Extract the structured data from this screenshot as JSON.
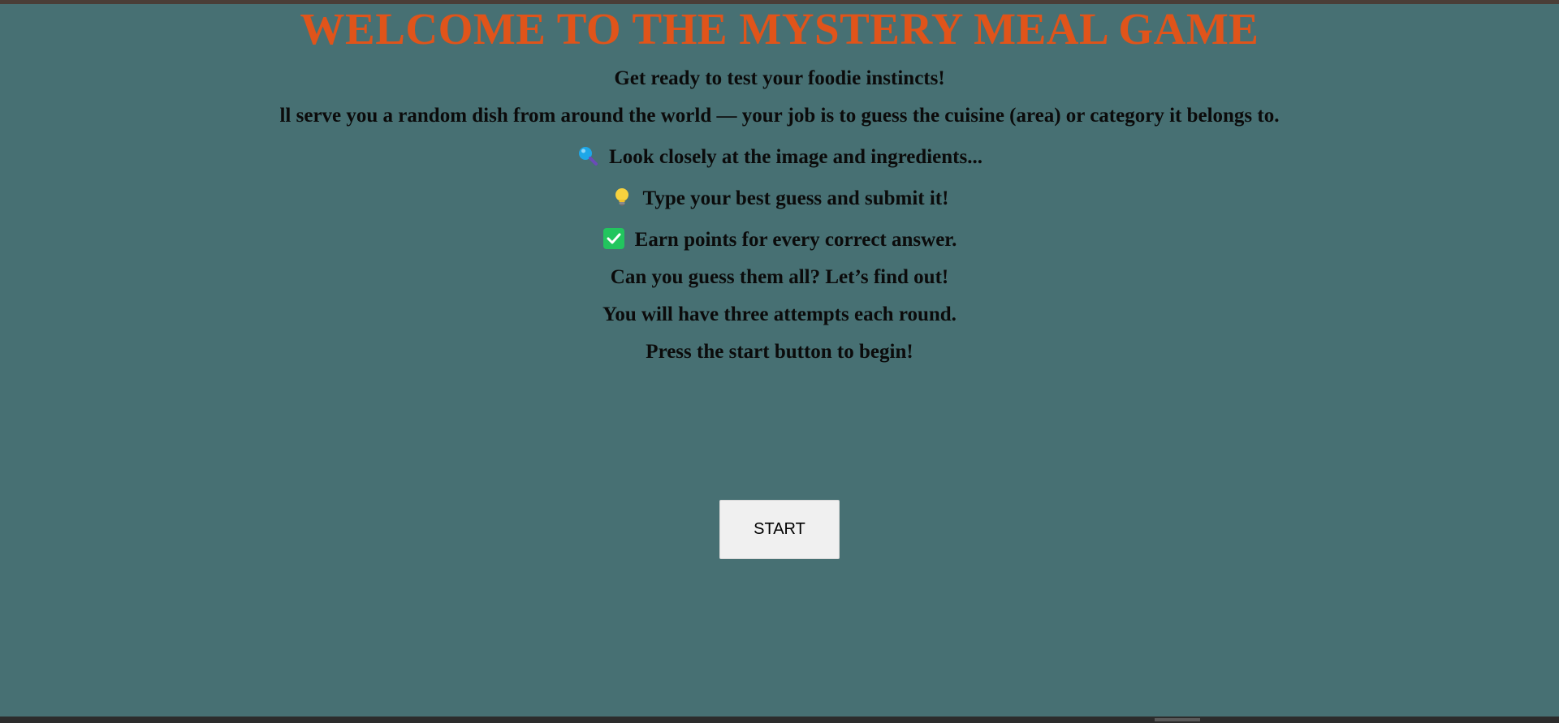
{
  "header": {
    "title": "WELCOME TO THE MYSTERY MEAL GAME"
  },
  "intro": {
    "tagline": "Get ready to test your foodie instincts!",
    "description": "ll serve you a random dish from around the world — your job is to guess the cuisine (area) or category it belongs to.",
    "steps": [
      {
        "icon": "magnifying-glass-icon",
        "text": "Look closely at the image and ingredients..."
      },
      {
        "icon": "light-bulb-icon",
        "text": "Type your best guess and submit it!"
      },
      {
        "icon": "check-mark-icon",
        "text": "Earn points for every correct answer."
      }
    ],
    "challenge": "Can you guess them all? Let’s find out!",
    "attempts": "You will have three attempts each round.",
    "instruction": "Press the start button to begin!"
  },
  "controls": {
    "start_label": "START"
  },
  "colors": {
    "background": "#477073",
    "title": "#e0541a",
    "text": "#0b0b0b",
    "button": "#f0f0f0",
    "check_green": "#22c55e"
  }
}
